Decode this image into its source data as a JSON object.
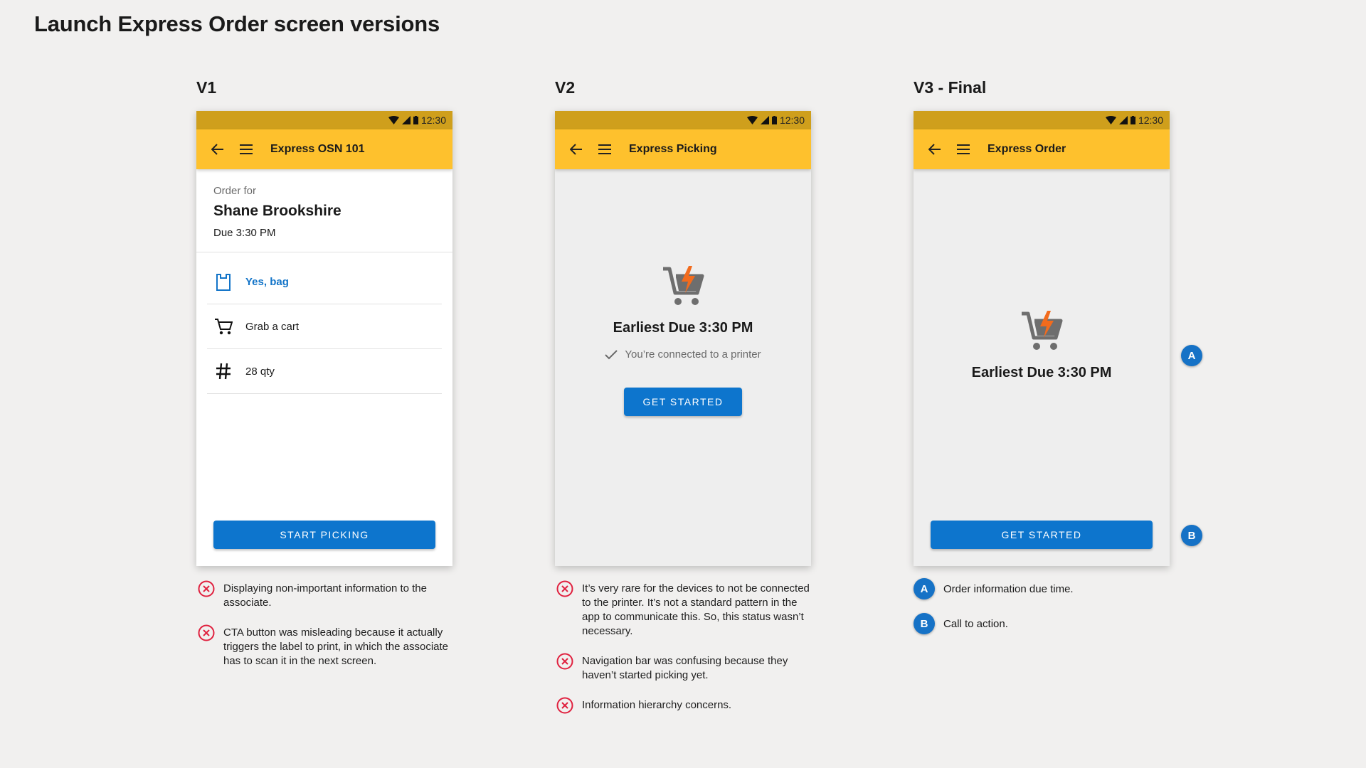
{
  "page": {
    "title": "Launch Express Order screen versions"
  },
  "status_bar": {
    "time": "12:30"
  },
  "colors": {
    "primary": "#0d75cd",
    "toolbar": "#fec12d",
    "statusbar": "#cf9f1c",
    "error": "#e0213f",
    "cart_bolt": "#f26b1d"
  },
  "v1": {
    "heading": "V1",
    "toolbar_title": "Express OSN 101",
    "order_label": "Order for",
    "customer_name": "Shane Brookshire",
    "due": "Due 3:30 PM",
    "items": [
      {
        "icon": "bag-icon",
        "label": "Yes, bag"
      },
      {
        "icon": "cart-icon",
        "label": "Grab a cart"
      },
      {
        "icon": "hash-icon",
        "label": "28 qty"
      }
    ],
    "button_label": "START PICKING",
    "notes": [
      "Displaying non-important information to the associate.",
      "CTA button was misleading because it actually triggers the label to print, in which the associate has to scan it in the next screen."
    ]
  },
  "v2": {
    "heading": "V2",
    "toolbar_title": "Express Picking",
    "due_text": "Earliest Due 3:30 PM",
    "printer_status": "You’re connected to a printer",
    "button_label": "GET STARTED",
    "notes": [
      "It’s very rare for the devices to not be connected to the printer. It’s not a standard pattern in the app to communicate this. So, this status wasn’t necessary.",
      "Navigation bar was confusing because they haven’t started picking yet.",
      "Information hierarchy concerns."
    ]
  },
  "v3": {
    "heading": "V3 - Final",
    "toolbar_title": "Express Order",
    "due_text": "Earliest Due 3:30 PM",
    "button_label": "GET STARTED",
    "markers": [
      {
        "letter": "A",
        "text": "Order information due time."
      },
      {
        "letter": "B",
        "text": "Call to action."
      }
    ]
  }
}
